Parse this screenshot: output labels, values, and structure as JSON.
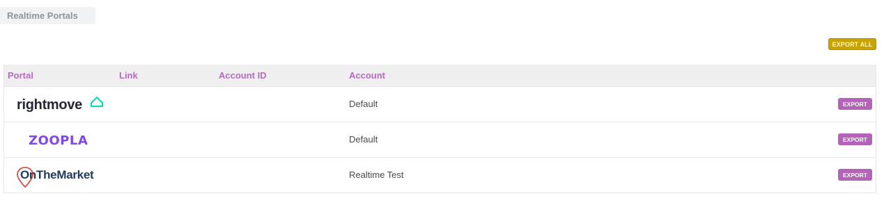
{
  "section": {
    "tab_label": "Realtime Portals"
  },
  "toolbar": {
    "export_all_label": "EXPORT ALL"
  },
  "table": {
    "headers": {
      "portal": "Portal",
      "link": "Link",
      "account_id": "Account ID",
      "account": "Account"
    },
    "rows": [
      {
        "portal": "rightmove",
        "link": "",
        "account_id": "",
        "account": "Default",
        "action": "EXPORT"
      },
      {
        "portal": "ZOOPLA",
        "link": "",
        "account_id": "",
        "account": "Default",
        "action": "EXPORT"
      },
      {
        "portal": "OnTheMarket",
        "link": "",
        "account_id": "",
        "account": "Realtime Test",
        "action": "EXPORT"
      }
    ]
  },
  "colors": {
    "header_text": "#b46bc0",
    "export_button": "#b463b8",
    "export_all_button": "#c9a400",
    "rightmove_accent": "#00deb6",
    "zoopla_purple": "#8046f1",
    "onthemarket_navy": "#1f3a5c",
    "onthemarket_pin": "#e4483c"
  },
  "icons": {
    "rightmove": "rightmove-house-icon",
    "onthemarket": "location-pin-icon"
  }
}
